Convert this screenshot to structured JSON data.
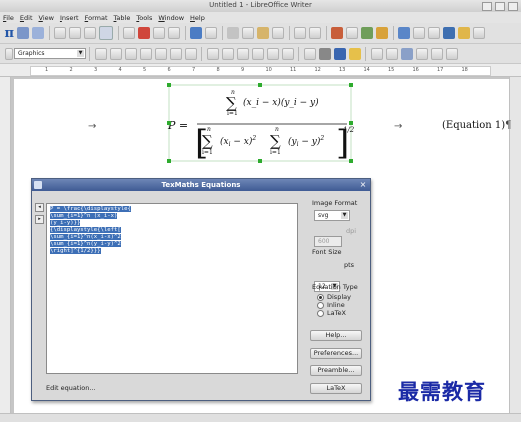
{
  "window": {
    "title": "Untitled 1 - LibreOffice Writer"
  },
  "menu": [
    {
      "label": "File",
      "key": "F",
      "rest": "ile"
    },
    {
      "label": "Edit",
      "key": "E",
      "rest": "dit"
    },
    {
      "label": "View",
      "key": "V",
      "rest": "iew"
    },
    {
      "label": "Insert",
      "key": "I",
      "rest": "nsert"
    },
    {
      "label": "Format",
      "key": "F",
      "rest": "ormat"
    },
    {
      "label": "Table",
      "key": "T",
      "rest": "able"
    },
    {
      "label": "Tools",
      "key": "T",
      "rest": "ools"
    },
    {
      "label": "Window",
      "key": "W",
      "rest": "indow"
    },
    {
      "label": "Help",
      "key": "H",
      "rest": "elp"
    }
  ],
  "toolbar": {
    "pi_symbol": "π",
    "style_dropdown": "Graphics",
    "font_dropdown": "",
    "size_dropdown": ""
  },
  "ruler": {
    "ticks": [
      "1",
      "2",
      "3",
      "4",
      "5",
      "6",
      "7",
      "8",
      "9",
      "10",
      "11",
      "12",
      "13",
      "14",
      "15",
      "16",
      "17",
      "18"
    ]
  },
  "document": {
    "arrow_mark": "→",
    "equation_label": "(Equation 1)",
    "pilcrow": "¶",
    "formula": {
      "lhs": "P =",
      "num_sum_upper": "n",
      "num_sum_lower": "i=1",
      "numerator": "(x_i − x)(y_i − y)",
      "exponent": "1/2"
    }
  },
  "dialog": {
    "title": "TexMaths Equations",
    "code_lines": [
      "P = \\frac{\\displaystyle{",
      "\\sum_{i=1}^n (x_i-x)",
      "(y_i-y)}}",
      "{\\displaystyle{\\left[",
      "\\sum_{i=1}^n(x_i-x)^2",
      "\\sum_{i=1}^n(y_i-y)^2",
      "\\right]^{1/2}}}"
    ],
    "edit_label": "Edit equation...",
    "image_format_label": "Image Format",
    "image_format_value": "svg",
    "dpi_value": "600",
    "dpi_unit": "dpi",
    "font_size_label": "Font Size",
    "font_size_value": "12",
    "font_size_unit": "pts",
    "equation_type_label": "Equation Type",
    "equation_types": [
      {
        "label": "Display",
        "selected": true
      },
      {
        "label": "Inline",
        "selected": false
      },
      {
        "label": "LaTeX",
        "selected": false
      }
    ],
    "buttons": {
      "help": "Help...",
      "preferences": "Preferences...",
      "preamble": "Preamble...",
      "latex": "LaTeX"
    }
  },
  "watermark": "最需教育"
}
